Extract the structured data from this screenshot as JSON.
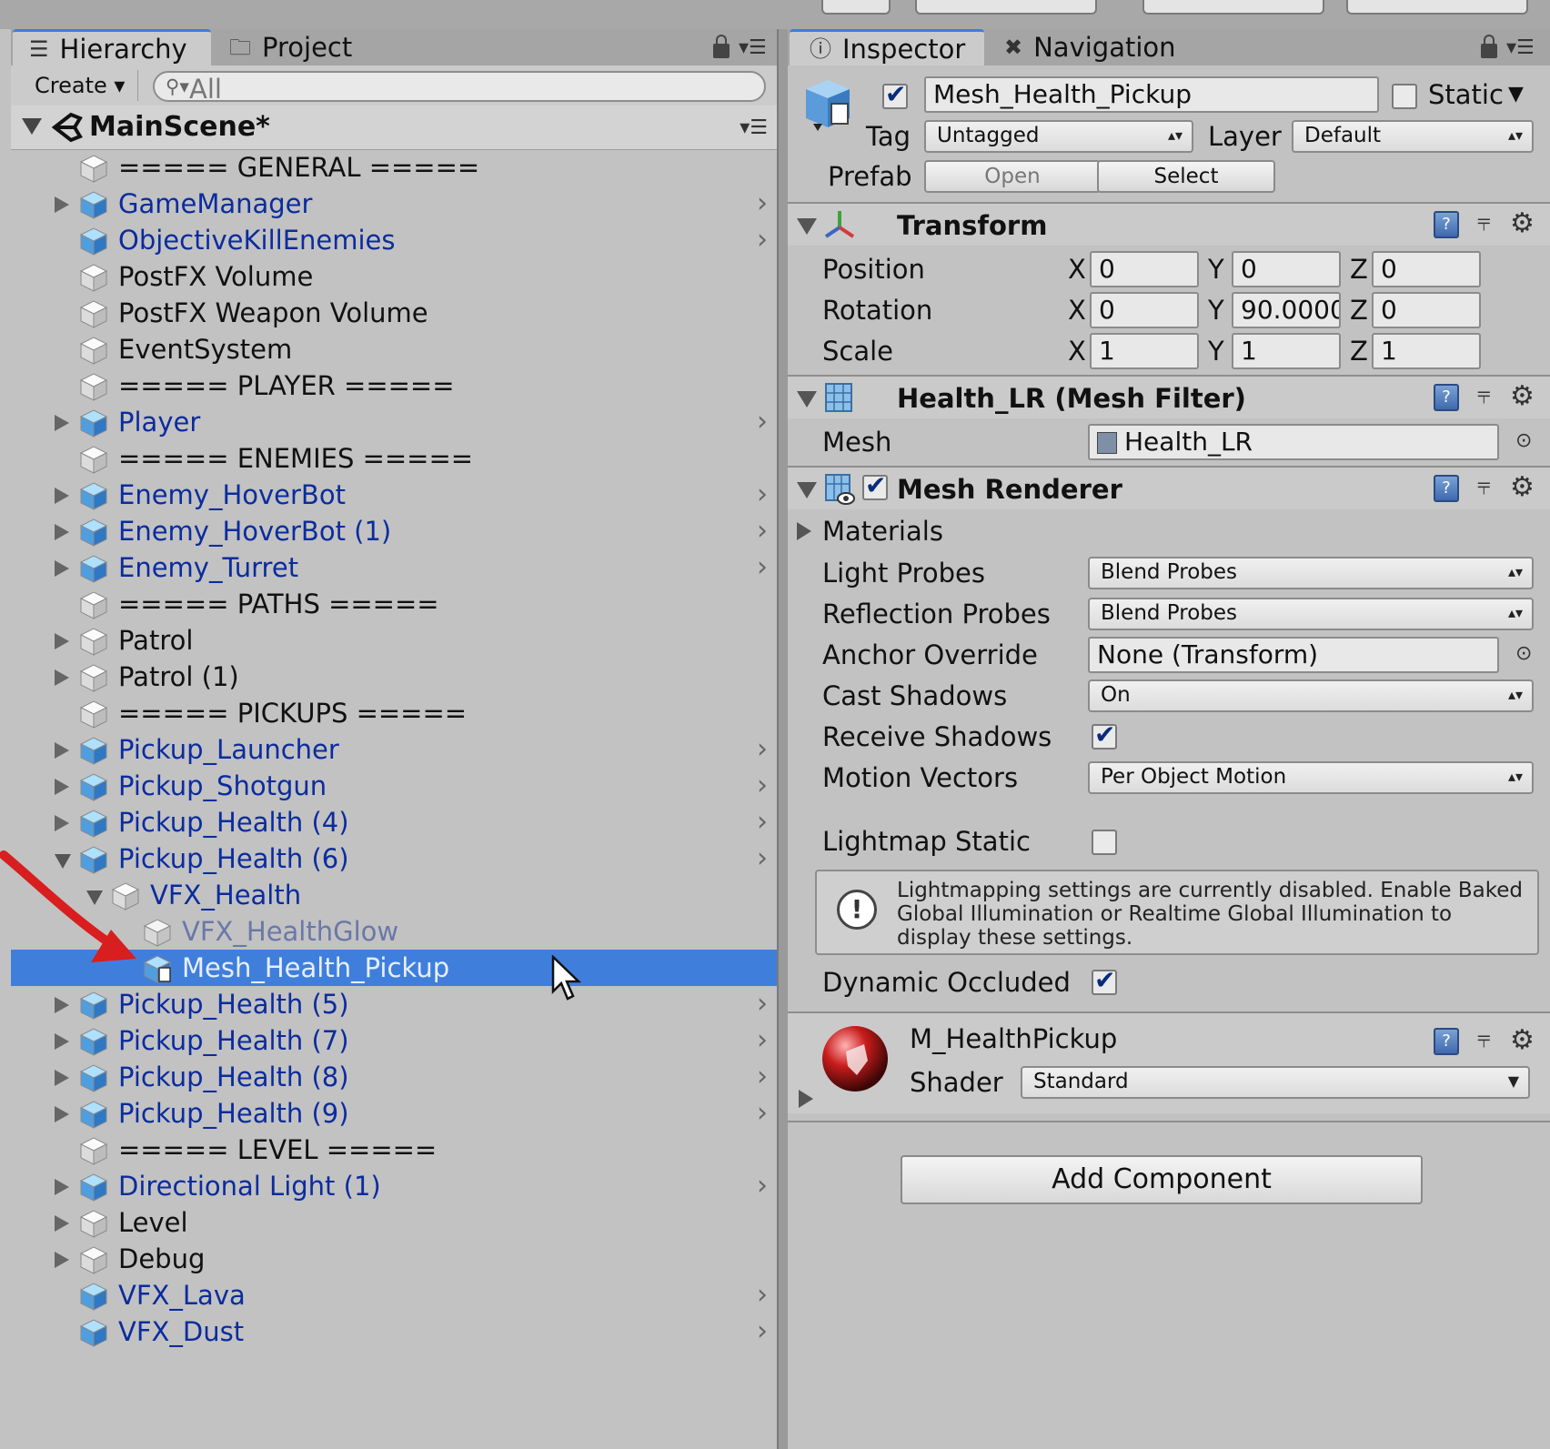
{
  "hierarchy": {
    "tab_label": "Hierarchy",
    "project_tab_label": "Project",
    "create_label": "Create ▾",
    "search_placeholder": "All",
    "scene_name": "MainScene*",
    "rows": [
      {
        "label": "===== GENERAL =====",
        "expand": "none",
        "prefab": false,
        "indent": 0,
        "chevron": false
      },
      {
        "label": "GameManager",
        "expand": "right",
        "prefab": true,
        "indent": 0,
        "chevron": true
      },
      {
        "label": "ObjectiveKillEnemies",
        "expand": "none",
        "prefab": true,
        "indent": 0,
        "chevron": true
      },
      {
        "label": "PostFX Volume",
        "expand": "none",
        "prefab": false,
        "indent": 0,
        "chevron": false
      },
      {
        "label": "PostFX Weapon Volume",
        "expand": "none",
        "prefab": false,
        "indent": 0,
        "chevron": false
      },
      {
        "label": "EventSystem",
        "expand": "none",
        "prefab": false,
        "indent": 0,
        "chevron": false
      },
      {
        "label": "===== PLAYER =====",
        "expand": "none",
        "prefab": false,
        "indent": 0,
        "chevron": false
      },
      {
        "label": "Player",
        "expand": "right",
        "prefab": true,
        "indent": 0,
        "chevron": true
      },
      {
        "label": "===== ENEMIES =====",
        "expand": "none",
        "prefab": false,
        "indent": 0,
        "chevron": false
      },
      {
        "label": "Enemy_HoverBot",
        "expand": "right",
        "prefab": true,
        "indent": 0,
        "chevron": true
      },
      {
        "label": "Enemy_HoverBot (1)",
        "expand": "right",
        "prefab": true,
        "indent": 0,
        "chevron": true
      },
      {
        "label": "Enemy_Turret",
        "expand": "right",
        "prefab": true,
        "indent": 0,
        "chevron": true
      },
      {
        "label": "===== PATHS =====",
        "expand": "none",
        "prefab": false,
        "indent": 0,
        "chevron": false
      },
      {
        "label": "Patrol",
        "expand": "right",
        "prefab": false,
        "indent": 0,
        "chevron": false
      },
      {
        "label": "Patrol (1)",
        "expand": "right",
        "prefab": false,
        "indent": 0,
        "chevron": false
      },
      {
        "label": "===== PICKUPS =====",
        "expand": "none",
        "prefab": false,
        "indent": 0,
        "chevron": false
      },
      {
        "label": "Pickup_Launcher",
        "expand": "right",
        "prefab": true,
        "indent": 0,
        "chevron": true
      },
      {
        "label": "Pickup_Shotgun",
        "expand": "right",
        "prefab": true,
        "indent": 0,
        "chevron": true
      },
      {
        "label": "Pickup_Health (4)",
        "expand": "right",
        "prefab": true,
        "indent": 0,
        "chevron": true
      },
      {
        "label": "Pickup_Health (6)",
        "expand": "down",
        "prefab": true,
        "indent": 0,
        "chevron": true
      },
      {
        "label": "VFX_Health",
        "expand": "down",
        "prefab": "child",
        "indent": 1,
        "chevron": false
      },
      {
        "label": "VFX_HealthGlow",
        "expand": "none",
        "prefab": "faded",
        "indent": 2,
        "chevron": false
      },
      {
        "label": "Mesh_Health_Pickup",
        "expand": "none",
        "prefab": "selected",
        "indent": 2,
        "chevron": false,
        "selected": true
      },
      {
        "label": "Pickup_Health (5)",
        "expand": "right",
        "prefab": true,
        "indent": 0,
        "chevron": true
      },
      {
        "label": "Pickup_Health (7)",
        "expand": "right",
        "prefab": true,
        "indent": 0,
        "chevron": true
      },
      {
        "label": "Pickup_Health (8)",
        "expand": "right",
        "prefab": true,
        "indent": 0,
        "chevron": true
      },
      {
        "label": "Pickup_Health (9)",
        "expand": "right",
        "prefab": true,
        "indent": 0,
        "chevron": true
      },
      {
        "label": "===== LEVEL =====",
        "expand": "none",
        "prefab": false,
        "indent": 0,
        "chevron": false
      },
      {
        "label": "Directional Light (1)",
        "expand": "right",
        "prefab": true,
        "indent": 0,
        "chevron": true
      },
      {
        "label": "Level",
        "expand": "right",
        "prefab": false,
        "indent": 0,
        "chevron": false
      },
      {
        "label": "Debug",
        "expand": "right",
        "prefab": false,
        "indent": 0,
        "chevron": false
      },
      {
        "label": "VFX_Lava",
        "expand": "none",
        "prefab": true,
        "indent": 0,
        "chevron": true
      },
      {
        "label": "VFX_Dust",
        "expand": "none",
        "prefab": true,
        "indent": 0,
        "chevron": true
      }
    ]
  },
  "inspector": {
    "tab_label": "Inspector",
    "navigation_tab_label": "Navigation",
    "object_name": "Mesh_Health_Pickup",
    "active": true,
    "static_label": "Static",
    "static_checked": false,
    "tag_label": "Tag",
    "tag_value": "Untagged",
    "layer_label": "Layer",
    "layer_value": "Default",
    "prefab_label": "Prefab",
    "prefab_open": "Open",
    "prefab_select": "Select",
    "transform": {
      "title": "Transform",
      "position_label": "Position",
      "rotation_label": "Rotation",
      "scale_label": "Scale",
      "x": "X",
      "y": "Y",
      "z": "Z",
      "position": [
        "0",
        "0",
        "0"
      ],
      "rotation": [
        "0",
        "90.0000",
        "0"
      ],
      "scale": [
        "1",
        "1",
        "1"
      ]
    },
    "mesh_filter": {
      "title": "Health_LR (Mesh Filter)",
      "mesh_label": "Mesh",
      "mesh_value": "Health_LR"
    },
    "mesh_renderer": {
      "title": "Mesh Renderer",
      "enabled": true,
      "materials_label": "Materials",
      "light_probes_label": "Light Probes",
      "light_probes_value": "Blend Probes",
      "reflection_probes_label": "Reflection Probes",
      "reflection_probes_value": "Blend Probes",
      "anchor_override_label": "Anchor Override",
      "anchor_override_value": "None (Transform)",
      "cast_shadows_label": "Cast Shadows",
      "cast_shadows_value": "On",
      "receive_shadows_label": "Receive Shadows",
      "receive_shadows": true,
      "motion_vectors_label": "Motion Vectors",
      "motion_vectors_value": "Per Object Motion",
      "lightmap_static_label": "Lightmap Static",
      "lightmap_static": false,
      "info_text": "Lightmapping settings are currently disabled. Enable Baked Global Illumination or Realtime Global Illumination to display these settings.",
      "dynamic_occluded_label": "Dynamic Occluded",
      "dynamic_occluded": true
    },
    "material": {
      "name": "M_HealthPickup",
      "shader_label": "Shader",
      "shader_value": "Standard"
    },
    "add_component_label": "Add Component"
  },
  "colors": {
    "selection": "#3f7fdb",
    "prefab_text": "#0b2c9e",
    "annotation_arrow": "#d81e1e"
  }
}
